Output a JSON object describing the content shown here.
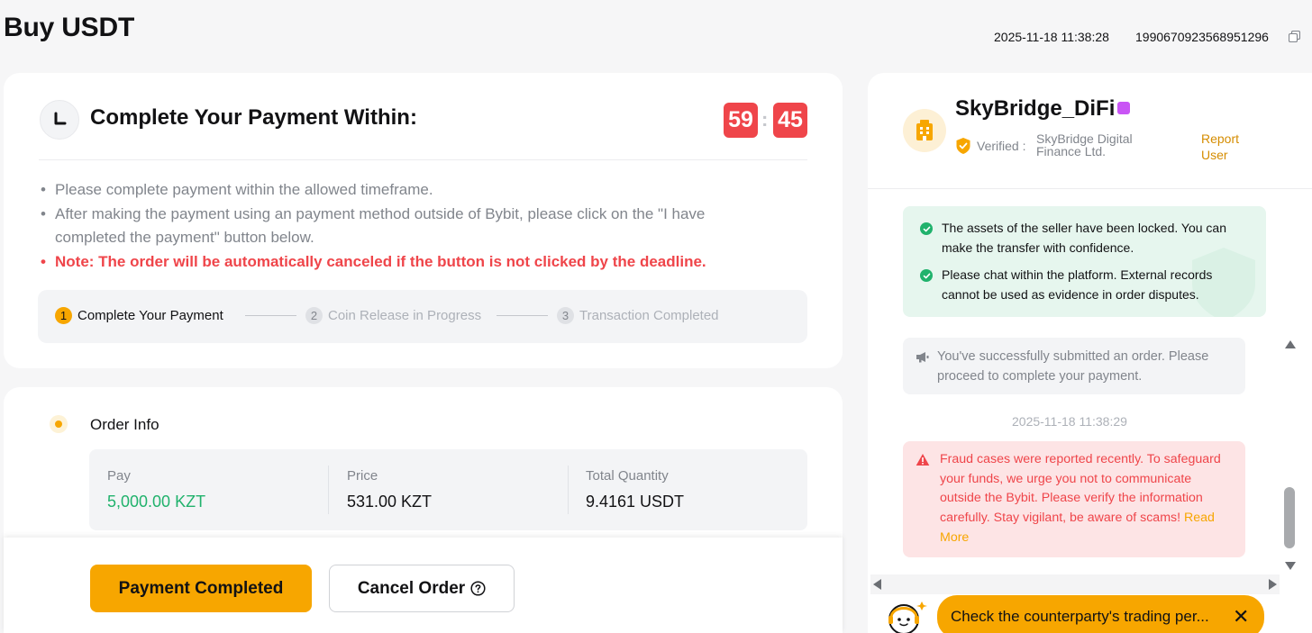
{
  "header": {
    "title": "Buy USDT",
    "timestamp": "2025-11-18 11:38:28",
    "order_id": "1990670923568951296"
  },
  "payment": {
    "title": "Complete Your Payment Within:",
    "timer_minutes": "59",
    "timer_seconds": "45",
    "timer_separator": ":",
    "notes": [
      "Please complete payment within the allowed timeframe.",
      "After making the payment using an payment method outside of Bybit, please click on the \"I have completed the payment\" button below.",
      "Note: The order will be automatically canceled if the button is not clicked by the deadline."
    ],
    "steps": [
      {
        "num": "1",
        "label": "Complete Your Payment"
      },
      {
        "num": "2",
        "label": "Coin Release in Progress"
      },
      {
        "num": "3",
        "label": "Transaction Completed"
      }
    ]
  },
  "order": {
    "title": "Order Info",
    "columns": [
      {
        "label": "Pay",
        "value": "5,000.00 KZT"
      },
      {
        "label": "Price",
        "value": "531.00 KZT"
      },
      {
        "label": "Total Quantity",
        "value": "9.4161 USDT"
      }
    ]
  },
  "actions": {
    "payment_completed": "Payment Completed",
    "cancel_order": "Cancel Order"
  },
  "chat": {
    "seller_name": "SkyBridge_DiFi",
    "verified_label": "Verified :",
    "verified_company": "SkyBridge Digital Finance Ltd.",
    "report_user": "Report User",
    "safe_messages": [
      "The assets of the seller have been locked. You can make the transfer with confidence.",
      "Please chat within the platform. External records cannot be used as evidence in order disputes."
    ],
    "system_message": "You've successfully submitted an order. Please proceed to complete your payment.",
    "message_time": "2025-11-18 11:38:29",
    "fraud_message": "Fraud cases were reported recently. To safeguard your funds, we urge you not to communicate outside the Bybit. Please verify the information carefully. Stay vigilant, be aware of scams!",
    "fraud_read_more": "Read More",
    "tip": "Check the counterparty's trading per...",
    "tip_close": "✕"
  },
  "colors": {
    "accent": "#f7a600",
    "danger": "#ef454a",
    "success": "#20b26c"
  }
}
